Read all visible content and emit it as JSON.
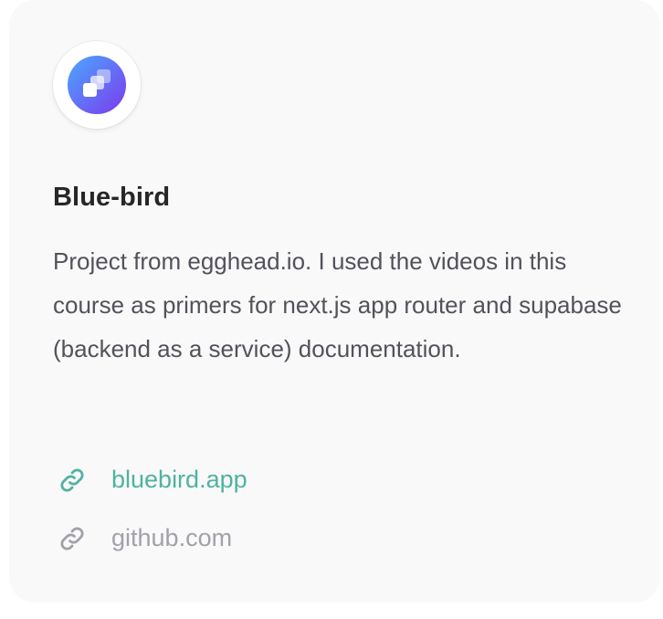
{
  "project": {
    "logo_icon": "stacked-squares-logo-icon",
    "title": "Blue-bird",
    "description": "Project from egghead.io. I used the videos in this course as primers for next.js app router and supabase (backend as a service) documentation."
  },
  "links": [
    {
      "label": "bluebird.app",
      "icon": "link-icon",
      "color": "#4fb3a0"
    },
    {
      "label": "github.com",
      "icon": "link-icon",
      "color": "#a1a1aa"
    }
  ],
  "colors": {
    "card_background": "#f9f9f9",
    "title": "#27272a",
    "body": "#52525b",
    "accent": "#4fb3a0",
    "muted": "#a1a1aa",
    "logo_gradient_start": "#5aa0ff",
    "logo_gradient_end": "#7b4dff"
  }
}
